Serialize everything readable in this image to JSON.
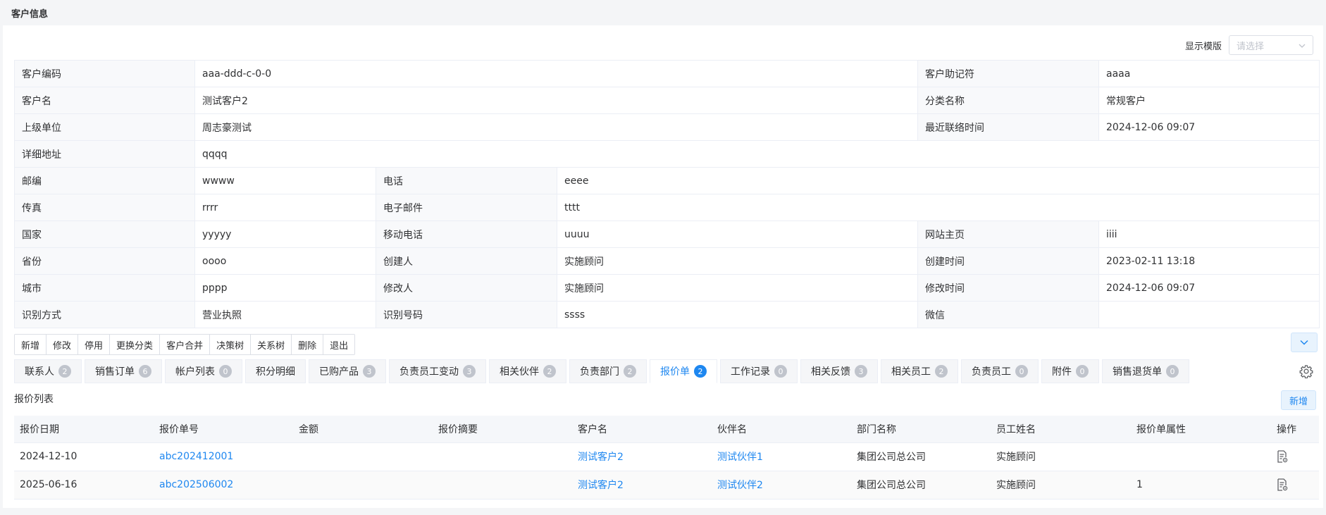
{
  "page": {
    "title": "客户信息"
  },
  "template": {
    "label": "显示模版",
    "placeholder": "请选择"
  },
  "fields": {
    "customer_code": {
      "label": "客户编码",
      "value": "aaa-ddd-c-0-0"
    },
    "mnemonic": {
      "label": "客户助记符",
      "value": "aaaa"
    },
    "customer_name": {
      "label": "客户名",
      "value": "测试客户2"
    },
    "category": {
      "label": "分类名称",
      "value": "常规客户"
    },
    "parent_unit": {
      "label": "上级单位",
      "value": "周志豪测试"
    },
    "last_contact": {
      "label": "最近联络时间",
      "value": "2024-12-06 09:07"
    },
    "address": {
      "label": "详细地址",
      "value": "qqqq"
    },
    "postcode": {
      "label": "邮编",
      "value": "wwww"
    },
    "phone": {
      "label": "电话",
      "value": "eeee"
    },
    "fax": {
      "label": "传真",
      "value": "rrrr"
    },
    "email": {
      "label": "电子邮件",
      "value": "tttt"
    },
    "country": {
      "label": "国家",
      "value": "yyyyy"
    },
    "mobile": {
      "label": "移动电话",
      "value": "uuuu"
    },
    "website": {
      "label": "网站主页",
      "value": "iiii"
    },
    "province": {
      "label": "省份",
      "value": "oooo"
    },
    "creator": {
      "label": "创建人",
      "value": "实施顾问"
    },
    "created_at": {
      "label": "创建时间",
      "value": "2023-02-11 13:18"
    },
    "city": {
      "label": "城市",
      "value": "pppp"
    },
    "modifier": {
      "label": "修改人",
      "value": "实施顾问"
    },
    "modified_at": {
      "label": "修改时间",
      "value": "2024-12-06 09:07"
    },
    "id_method": {
      "label": "识别方式",
      "value": "营业执照"
    },
    "id_number": {
      "label": "识别号码",
      "value": "ssss"
    },
    "wechat": {
      "label": "微信",
      "value": ""
    }
  },
  "toolbar": [
    "新增",
    "修改",
    "停用",
    "更换分类",
    "客户合并",
    "决策树",
    "关系树",
    "删除",
    "退出"
  ],
  "tabs": [
    {
      "label": "联系人",
      "count": "2"
    },
    {
      "label": "销售订单",
      "count": "6"
    },
    {
      "label": "帐户列表",
      "count": "0"
    },
    {
      "label": "积分明细",
      "count": ""
    },
    {
      "label": "已购产品",
      "count": "3"
    },
    {
      "label": "负责员工变动",
      "count": "3"
    },
    {
      "label": "相关伙伴",
      "count": "2"
    },
    {
      "label": "负责部门",
      "count": "2"
    },
    {
      "label": "报价单",
      "count": "2",
      "active": true
    },
    {
      "label": "工作记录",
      "count": "0"
    },
    {
      "label": "相关反馈",
      "count": "3"
    },
    {
      "label": "相关员工",
      "count": "2"
    },
    {
      "label": "负责员工",
      "count": "0"
    },
    {
      "label": "附件",
      "count": "0"
    },
    {
      "label": "销售退货单",
      "count": "0"
    }
  ],
  "quote_list": {
    "title": "报价列表",
    "add_label": "新增",
    "columns": [
      "报价日期",
      "报价单号",
      "金额",
      "报价摘要",
      "客户名",
      "伙伴名",
      "部门名称",
      "员工姓名",
      "报价单属性",
      "操作"
    ],
    "rows": [
      {
        "date": "2024-12-10",
        "no": "abc202412001",
        "amount": "",
        "summary": "",
        "customer": "测试客户2",
        "partner": "测试伙伴1",
        "dept": "集团公司总公司",
        "staff": "实施顾问",
        "attr": ""
      },
      {
        "date": "2025-06-16",
        "no": "abc202506002",
        "amount": "",
        "summary": "",
        "customer": "测试客户2",
        "partner": "测试伙伴2",
        "dept": "集团公司总公司",
        "staff": "实施顾问",
        "attr": "1"
      }
    ]
  },
  "icons": {
    "collapse": "chevron-down-icon",
    "settings": "gear-icon",
    "row_action": "document-view-icon",
    "select": "chevron-down-icon"
  },
  "colors": {
    "accent": "#1e87f0",
    "label_bg": "#f8f9fb",
    "border": "#ebeef5"
  }
}
